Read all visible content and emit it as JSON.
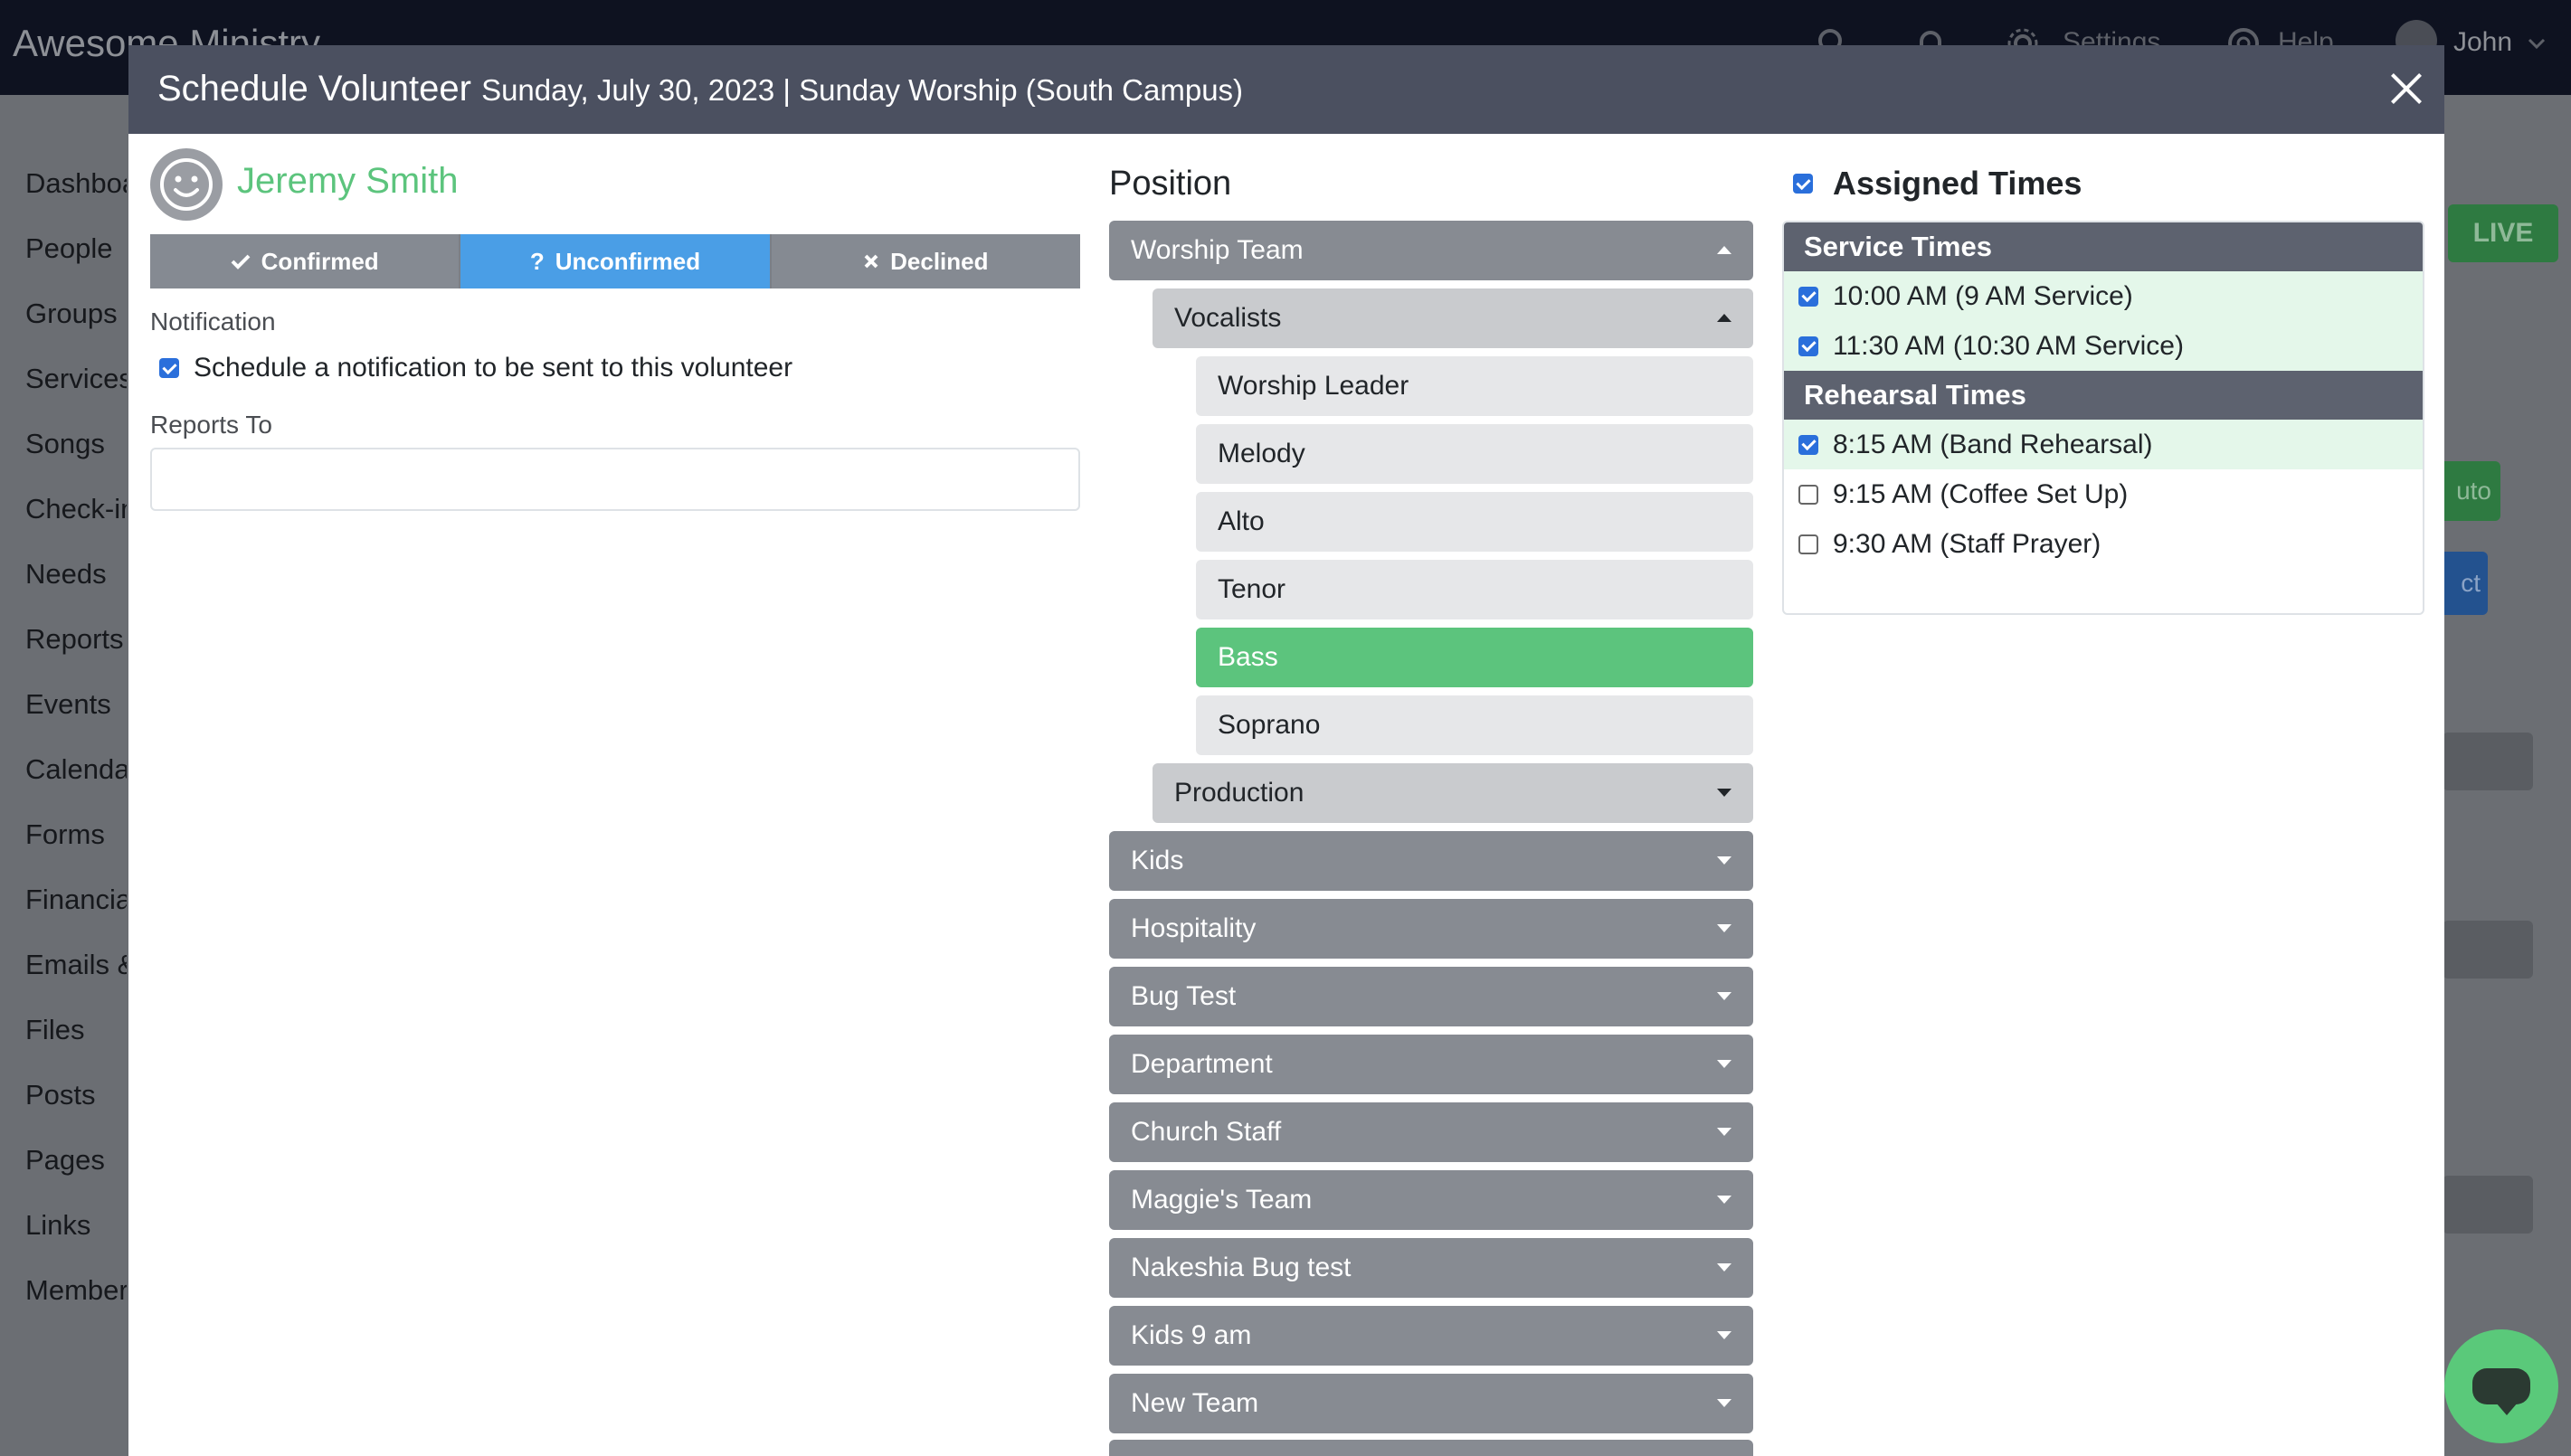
{
  "app": {
    "brand": "Awesome Ministry",
    "top_nav": {
      "settings": "Settings",
      "help": "Help",
      "user": "John"
    },
    "sidebar": [
      "Dashboard",
      "People",
      "Groups",
      "Services",
      "Songs",
      "Check-in",
      "Needs",
      "Reports",
      "Events",
      "Calendar",
      "Forms",
      "Financial",
      "Emails &",
      "Files",
      "Posts",
      "Pages",
      "Links",
      "Members"
    ],
    "live_label": "LIVE",
    "bg_button_1": "uto",
    "bg_button_2": "ct"
  },
  "modal": {
    "title": "Schedule Volunteer",
    "subtitle": "Sunday, July 30, 2023 | Sunday Worship (South Campus)",
    "volunteer": {
      "name": "Jeremy Smith",
      "statuses": [
        {
          "label": "Confirmed",
          "icon": "check-icon",
          "active": false
        },
        {
          "label": "Unconfirmed",
          "icon": "question-icon",
          "active": true
        },
        {
          "label": "Declined",
          "icon": "x-icon",
          "active": false
        }
      ]
    },
    "notification": {
      "label": "Notification",
      "checkbox_label": "Schedule a notification to be sent to this volunteer",
      "checked": true
    },
    "reports_to": {
      "label": "Reports To",
      "value": ""
    },
    "position": {
      "heading": "Position",
      "items": [
        {
          "label": "Worship Team",
          "level": 0,
          "expanded": true
        },
        {
          "label": "Vocalists",
          "level": 1,
          "expanded": true
        },
        {
          "label": "Worship Leader",
          "level": 2
        },
        {
          "label": "Melody",
          "level": 2
        },
        {
          "label": "Alto",
          "level": 2
        },
        {
          "label": "Tenor",
          "level": 2
        },
        {
          "label": "Bass",
          "level": 2,
          "selected": true
        },
        {
          "label": "Soprano",
          "level": 2
        },
        {
          "label": "Production",
          "level": 1,
          "expanded": false
        },
        {
          "label": "Kids",
          "level": 0,
          "expanded": false
        },
        {
          "label": "Hospitality",
          "level": 0,
          "expanded": false
        },
        {
          "label": "Bug Test",
          "level": 0,
          "expanded": false
        },
        {
          "label": "Department",
          "level": 0,
          "expanded": false
        },
        {
          "label": "Church Staff",
          "level": 0,
          "expanded": false
        },
        {
          "label": "Maggie's Team",
          "level": 0,
          "expanded": false
        },
        {
          "label": "Nakeshia Bug test",
          "level": 0,
          "expanded": false
        },
        {
          "label": "Kids 9 am",
          "level": 0,
          "expanded": false
        },
        {
          "label": "New Team",
          "level": 0,
          "expanded": false
        }
      ]
    },
    "assigned_times": {
      "heading": "Assigned Times",
      "checked": true,
      "groups": [
        {
          "title": "Service Times",
          "times": [
            {
              "label": "10:00 AM (9 AM Service)",
              "checked": true
            },
            {
              "label": "11:30 AM (10:30 AM Service)",
              "checked": true
            }
          ]
        },
        {
          "title": "Rehearsal Times",
          "times": [
            {
              "label": "8:15 AM (Band Rehearsal)",
              "checked": true
            },
            {
              "label": "9:15 AM (Coffee Set Up)",
              "checked": false
            },
            {
              "label": "9:30 AM (Staff Prayer)",
              "checked": false
            }
          ]
        }
      ]
    }
  }
}
